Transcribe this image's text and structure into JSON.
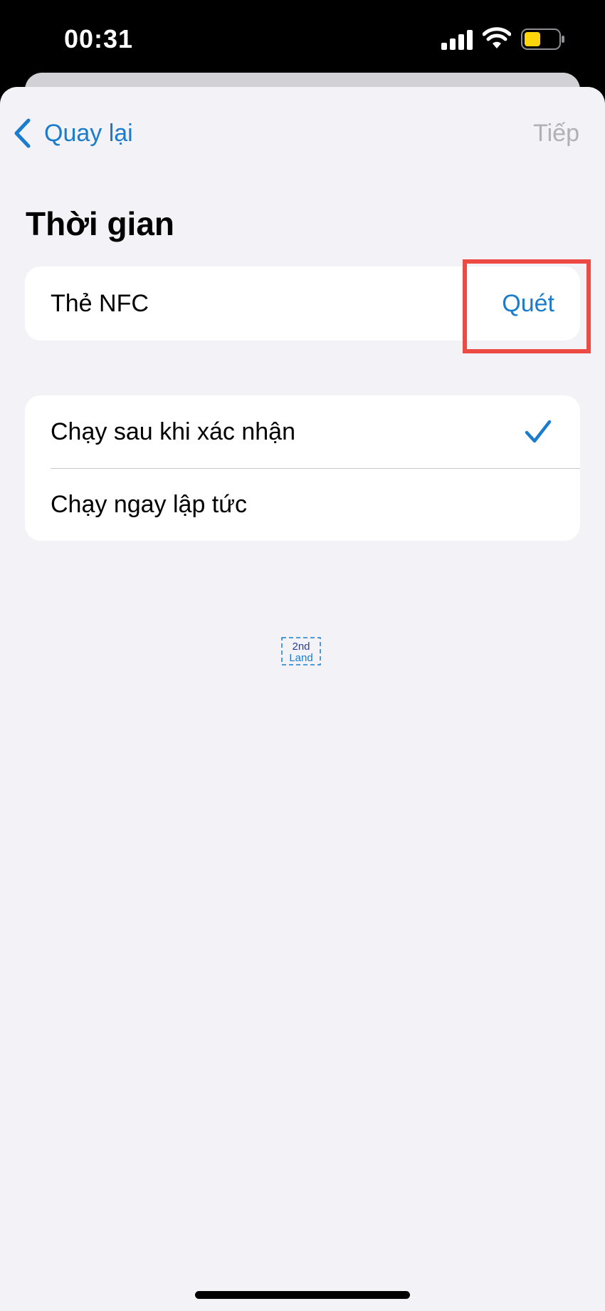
{
  "status_bar": {
    "time": "00:31",
    "icons": [
      "signal-icon",
      "wifi-icon",
      "battery-icon"
    ]
  },
  "nav": {
    "back_label": "Quay lại",
    "next_label": "Tiếp"
  },
  "section": {
    "title": "Thời gian"
  },
  "nfc_row": {
    "label": "Thẻ NFC",
    "action_label": "Quét"
  },
  "options": [
    {
      "label": "Chạy sau khi xác nhận",
      "selected": true
    },
    {
      "label": "Chạy ngay lập tức",
      "selected": false
    }
  ],
  "watermark": {
    "line1": "2nd",
    "line2": "Land"
  },
  "colors": {
    "accent": "#1a7ccc",
    "disabled": "#b0b0b5",
    "background": "#f2f2f7",
    "highlight": "#ee4a44",
    "battery_fill": "#ffd60a"
  }
}
